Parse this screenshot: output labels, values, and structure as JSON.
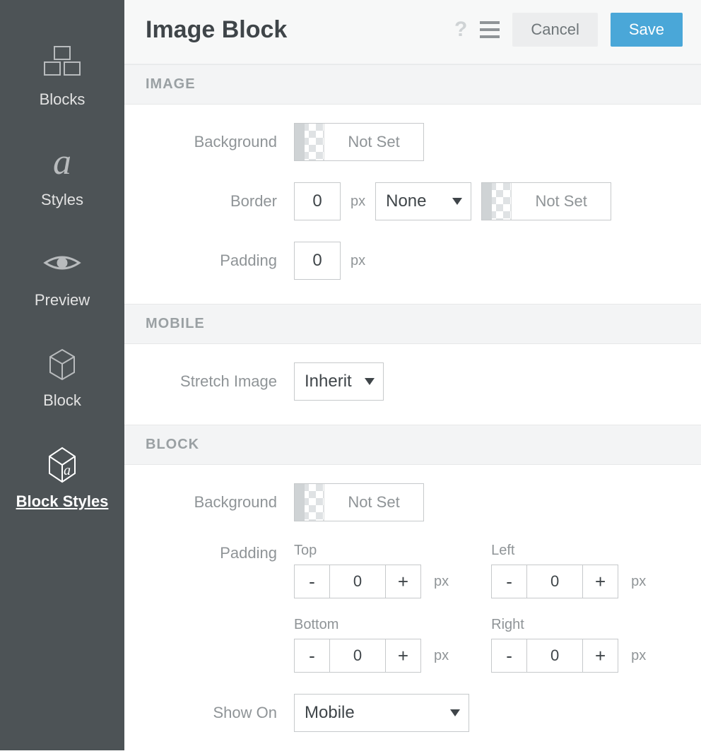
{
  "sidebar": {
    "items": [
      {
        "label": "Blocks"
      },
      {
        "label": "Styles"
      },
      {
        "label": "Preview"
      },
      {
        "label": "Block"
      },
      {
        "label": "Block Styles"
      }
    ]
  },
  "header": {
    "title": "Image Block",
    "cancel_label": "Cancel",
    "save_label": "Save"
  },
  "sections": {
    "image": {
      "heading": "IMAGE",
      "background_label": "Background",
      "background_value": "Not Set",
      "border_label": "Border",
      "border_width": "0",
      "border_unit": "px",
      "border_style": "None",
      "border_color": "Not Set",
      "padding_label": "Padding",
      "padding_value": "0",
      "padding_unit": "px"
    },
    "mobile": {
      "heading": "MOBILE",
      "stretch_label": "Stretch Image",
      "stretch_value": "Inherit"
    },
    "block": {
      "heading": "BLOCK",
      "background_label": "Background",
      "background_value": "Not Set",
      "padding_label": "Padding",
      "top_label": "Top",
      "bottom_label": "Bottom",
      "left_label": "Left",
      "right_label": "Right",
      "top_value": "0",
      "bottom_value": "0",
      "left_value": "0",
      "right_value": "0",
      "unit": "px",
      "showon_label": "Show On",
      "showon_value": "Mobile"
    }
  },
  "glyphs": {
    "minus": "-",
    "plus": "+"
  }
}
